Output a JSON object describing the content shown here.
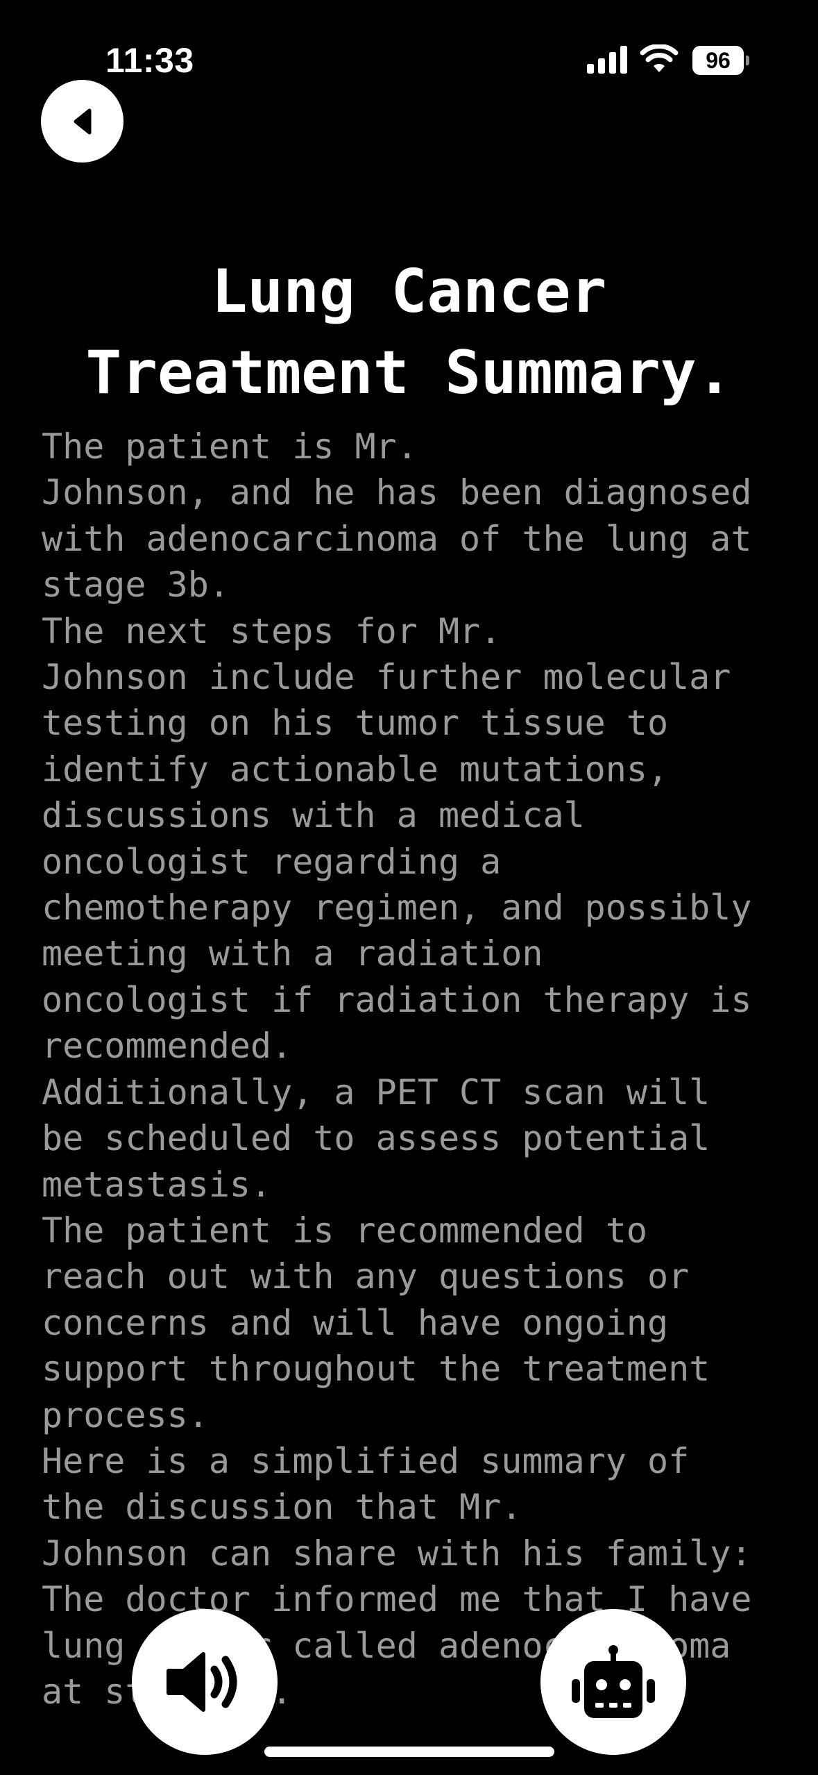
{
  "status_bar": {
    "time": "11:33",
    "battery_level": "96",
    "icons": [
      "signal-icon",
      "wifi-icon",
      "battery-icon"
    ]
  },
  "header": {
    "back_icon": "back-arrow-icon"
  },
  "page": {
    "title": "Lung Cancer\nTreatment Summary.",
    "summary_text": "The patient is Mr.\nJohnson, and he has been diagnosed\nwith adenocarcinoma of the lung at\nstage 3b.\nThe next steps for Mr.\nJohnson include further molecular\ntesting on his tumor tissue to\nidentify actionable mutations,\ndiscussions with a medical\noncologist regarding a\nchemotherapy regimen, and possibly\nmeeting with a radiation\noncologist if radiation therapy is\nrecommended.\nAdditionally, a PET CT scan will\nbe scheduled to assess potential\nmetastasis.\nThe patient is recommended to\nreach out with any questions or\nconcerns and will have ongoing\nsupport throughout the treatment\nprocess.\nHere is a simplified summary of\nthe discussion that Mr.\nJohnson can share with his family:\nThe doctor informed me that I have\nlung cancer called adenocarcinoma\nat stage 3b."
  },
  "actions": {
    "speaker_icon": "speaker-icon",
    "assistant_icon": "robot-icon"
  },
  "colors": {
    "background": "#000000",
    "title": "#ffffff",
    "body_text": "#9a9a9a",
    "button_fill": "#ffffff"
  }
}
